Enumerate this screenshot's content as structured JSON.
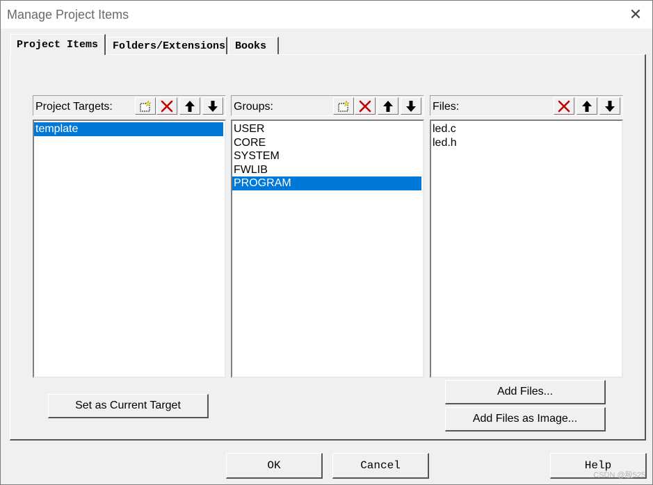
{
  "window": {
    "title": "Manage Project Items",
    "close_glyph": "✕"
  },
  "tabs": [
    {
      "label": "Project Items",
      "active": true
    },
    {
      "label": "Folders/Extensions",
      "active": false
    },
    {
      "label": "Books",
      "active": false
    }
  ],
  "targets": {
    "label": "Project Targets:",
    "items": [
      "template"
    ],
    "selected": "template"
  },
  "groups": {
    "label": "Groups:",
    "items": [
      "USER",
      "CORE",
      "SYSTEM",
      "FWLIB",
      "PROGRAM"
    ],
    "selected": "PROGRAM"
  },
  "files": {
    "label": "Files:",
    "items": [
      "led.c",
      "led.h"
    ]
  },
  "buttons": {
    "set_current_target": "Set as Current Target",
    "add_files": "Add Files...",
    "add_files_as_image": "Add Files as Image...",
    "ok": "OK",
    "cancel": "Cancel",
    "help": "Help"
  },
  "watermark": "CSDN @殷525",
  "icons": {
    "new": "new-item-icon",
    "delete": "delete-x-icon",
    "up": "move-up-icon",
    "down": "move-down-icon"
  },
  "colors": {
    "selection": "#0078d7",
    "delete_red": "#c00000"
  }
}
